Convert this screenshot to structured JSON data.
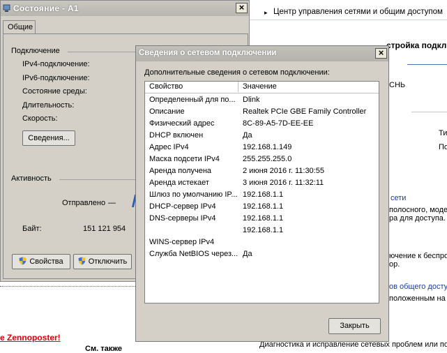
{
  "background_window": {
    "breadcrumb_arrow": "▸",
    "breadcrumb": "Центр управления сетями и общим доступом",
    "heading_partial": "стройка подкл",
    "side_text_1": "СНЬ",
    "side_text_2": "Ти",
    "side_text_3": "По",
    "link_network": "сети",
    "text_broadband": "полосного, модем",
    "text_access": "ра для доступа.",
    "text_wireless": "ючение к беспро",
    "text_or": "ор.",
    "link_shared": "ов общего досту",
    "text_placed": "положенным на др",
    "text_diagnostics": "Диагностика и исправление сетевых проблем или по"
  },
  "web_page": {
    "zennoposter": "e Zennoposter!",
    "see_also": "См. также"
  },
  "status_window": {
    "title": "Состояние - A1",
    "close": "×",
    "tab_general": "Общие",
    "group_connection": "Подключение",
    "ipv4": "IPv4-подключение:",
    "ipv6": "IPv6-подключение:",
    "media_state": "Состояние среды:",
    "duration": "Длительность:",
    "speed": "Скорость:",
    "details_button": "Сведения...",
    "group_activity": "Активность",
    "sent": "Отправлено",
    "sent_dash": "—",
    "bytes_label": "Байт:",
    "bytes_value": "151 121 954",
    "properties_button": "Свойства",
    "disable_button": "Отключить"
  },
  "details_dialog": {
    "title": "Сведения о сетевом подключении",
    "close": "×",
    "label": "Дополнительные сведения о сетевом подключении:",
    "columns": {
      "property": "Свойство",
      "value": "Значение"
    },
    "rows": [
      {
        "key": "Определенный для по...",
        "value": "Dlink"
      },
      {
        "key": "Описание",
        "value": "Realtek PCIe GBE Family Controller"
      },
      {
        "key": "Физический адрес",
        "value": "8C-89-A5-7D-EE-EE"
      },
      {
        "key": "DHCP включен",
        "value": "Да"
      },
      {
        "key": "Адрес IPv4",
        "value": "192.168.1.149"
      },
      {
        "key": "Маска подсети IPv4",
        "value": "255.255.255.0"
      },
      {
        "key": "Аренда получена",
        "value": "2 июня 2016 г. 11:30:55"
      },
      {
        "key": "Аренда истекает",
        "value": "3 июня 2016 г. 11:32:11"
      },
      {
        "key": "Шлюз по умолчанию IP...",
        "value": "192.168.1.1"
      },
      {
        "key": "DHCP-сервер IPv4",
        "value": "192.168.1.1"
      },
      {
        "key": "DNS-серверы IPv4",
        "value": "192.168.1.1"
      },
      {
        "key": "",
        "value": "192.168.1.1"
      },
      {
        "key": "WINS-сервер IPv4",
        "value": ""
      },
      {
        "key": "Служба NetBIOS через...",
        "value": "Да"
      }
    ],
    "close_button": "Закрыть"
  }
}
